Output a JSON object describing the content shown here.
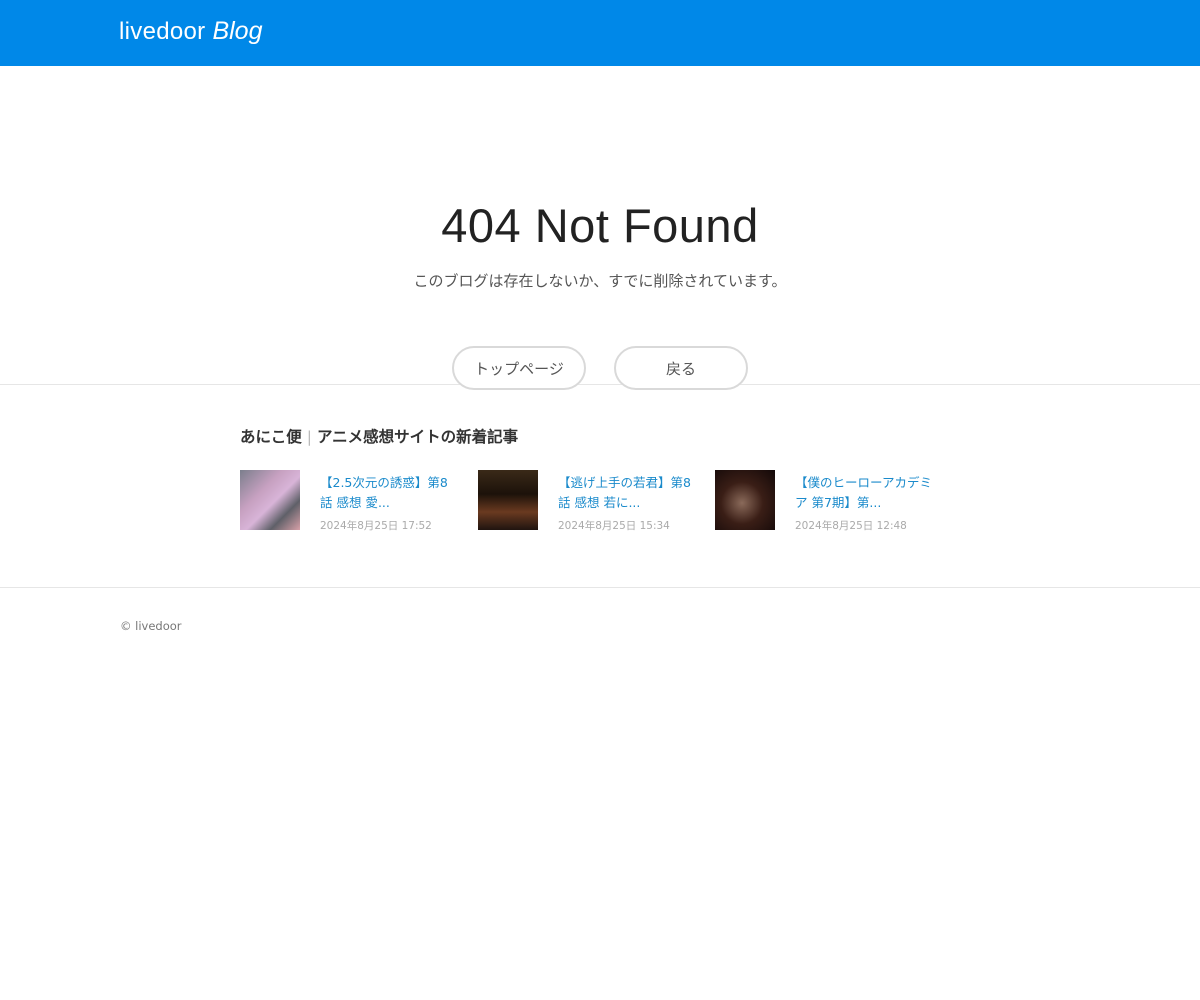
{
  "header": {
    "logo_main": "livedoor",
    "logo_sub": "Blog",
    "color": "#0088e8"
  },
  "error": {
    "title": "404 Not Found",
    "message": "このブログは存在しないか、すでに削除されています。"
  },
  "buttons": {
    "top_page": "トップページ",
    "back": "戻る"
  },
  "related": {
    "blog_name": "あにこ便",
    "separator": "|",
    "section_label": "アニメ感想サイトの新着記事",
    "articles": [
      {
        "title": "【2.5次元の誘惑】第8話 感想 愛...",
        "date": "2024年8月25日 17:52"
      },
      {
        "title": "【逃げ上手の若君】第8話 感想 若に...",
        "date": "2024年8月25日 15:34"
      },
      {
        "title": "【僕のヒーローアカデミア 第7期】第...",
        "date": "2024年8月25日 12:48"
      }
    ]
  },
  "footer": {
    "copyright": "© livedoor"
  }
}
